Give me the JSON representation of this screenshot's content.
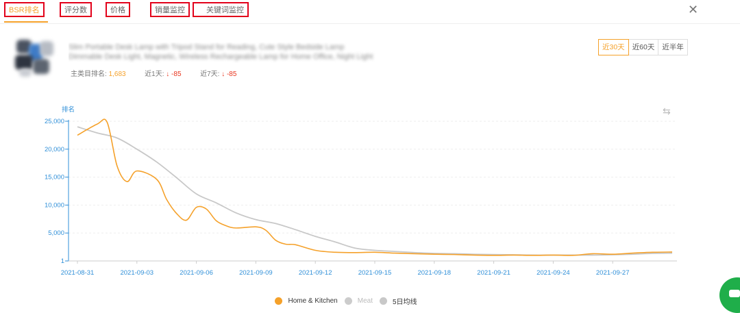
{
  "tabs": [
    {
      "label": "BSR排名",
      "active": true
    },
    {
      "label": "评分数",
      "active": false
    },
    {
      "label": "价格",
      "active": false
    },
    {
      "label": "销量监控",
      "active": false
    },
    {
      "label": "关键词监控",
      "active": false
    }
  ],
  "close_label": "✕",
  "product": {
    "title_line1": "Slim Portable Desk Lamp with Tripod Stand for Reading, Cute Style Bedside Lamp",
    "title_line2": "Dimmable Desk Light, Magnetic, Wireless Rechargeable Lamp for Home Office, Night Light"
  },
  "rank_info": {
    "main_label": "主类目排名:",
    "main_value": "1,683",
    "day1_label": "近1天:",
    "day1_value": "↓ -85",
    "day7_label": "近7天:",
    "day7_value": "↓ -85"
  },
  "range_buttons": [
    {
      "label": "近30天",
      "active": true
    },
    {
      "label": "近60天",
      "active": false
    },
    {
      "label": "近半年",
      "active": false
    }
  ],
  "toggle_icon": "⇆",
  "colors": {
    "accent": "#f5a12a",
    "gray_line": "#c8c8c8",
    "axis": "#2f8fd8",
    "down": "#e8361f"
  },
  "chart_data": {
    "type": "line",
    "ylabel": "排名",
    "ylim": [
      1,
      25000
    ],
    "yticks": [
      "25,000",
      "20,000",
      "15,000",
      "10,000",
      "5,000",
      "1"
    ],
    "ytick_values": [
      25000,
      20000,
      15000,
      10000,
      5000,
      1
    ],
    "xlim": [
      "2021-08-31",
      "2021-09-30"
    ],
    "xticks": [
      "2021-08-31",
      "2021-09-03",
      "2021-09-06",
      "2021-09-09",
      "2021-09-12",
      "2021-09-15",
      "2021-09-18",
      "2021-09-21",
      "2021-09-24",
      "2021-09-27"
    ],
    "grid": true,
    "legend_position": "bottom-center",
    "series": [
      {
        "name": "Home & Kitchen",
        "color": "#f5a12a",
        "active": true,
        "x": [
          "2021-08-31",
          "2021-09-01",
          "2021-09-01",
          "2021-09-02",
          "2021-09-02",
          "2021-09-03",
          "2021-09-04",
          "2021-09-04",
          "2021-09-05",
          "2021-09-05",
          "2021-09-06",
          "2021-09-06",
          "2021-09-07",
          "2021-09-07",
          "2021-09-08",
          "2021-09-09",
          "2021-09-09",
          "2021-09-10",
          "2021-09-10",
          "2021-09-11",
          "2021-09-12",
          "2021-09-13",
          "2021-09-14",
          "2021-09-15",
          "2021-09-16",
          "2021-09-17",
          "2021-09-18",
          "2021-09-19",
          "2021-09-20",
          "2021-09-21",
          "2021-09-22",
          "2021-09-23",
          "2021-09-24",
          "2021-09-25",
          "2021-09-26",
          "2021-09-27",
          "2021-09-28",
          "2021-09-29",
          "2021-09-30"
        ],
        "values": [
          22500,
          24500,
          24800,
          17000,
          14200,
          16100,
          14600,
          11000,
          8500,
          7300,
          9600,
          9300,
          7200,
          6300,
          5900,
          6100,
          5500,
          3700,
          3000,
          2900,
          1900,
          1550,
          1500,
          1550,
          1400,
          1300,
          1200,
          1150,
          1050,
          1000,
          1050,
          1000,
          1050,
          1000,
          1300,
          1200,
          1400,
          1550,
          1600
        ]
      },
      {
        "name": "Meat",
        "color": "#cccccc",
        "active": false,
        "x": [],
        "values": []
      },
      {
        "name": "5日均线",
        "color": "#c8c8c8",
        "active": true,
        "x": [
          "2021-08-31",
          "2021-09-01",
          "2021-09-02",
          "2021-09-03",
          "2021-09-04",
          "2021-09-05",
          "2021-09-06",
          "2021-09-07",
          "2021-09-08",
          "2021-09-09",
          "2021-09-10",
          "2021-09-11",
          "2021-09-12",
          "2021-09-13",
          "2021-09-14",
          "2021-09-15",
          "2021-09-16",
          "2021-09-17",
          "2021-09-18",
          "2021-09-19",
          "2021-09-20",
          "2021-09-21",
          "2021-09-22",
          "2021-09-23",
          "2021-09-24",
          "2021-09-25",
          "2021-09-26",
          "2021-09-27",
          "2021-09-28",
          "2021-09-29",
          "2021-09-30"
        ],
        "values": [
          24000,
          22900,
          22000,
          20000,
          17700,
          14900,
          12000,
          10400,
          8600,
          7400,
          6700,
          5600,
          4400,
          3400,
          2300,
          1900,
          1700,
          1500,
          1350,
          1300,
          1200,
          1150,
          1100,
          1050,
          1050,
          1050,
          1050,
          1100,
          1200,
          1350,
          1400
        ]
      }
    ]
  }
}
